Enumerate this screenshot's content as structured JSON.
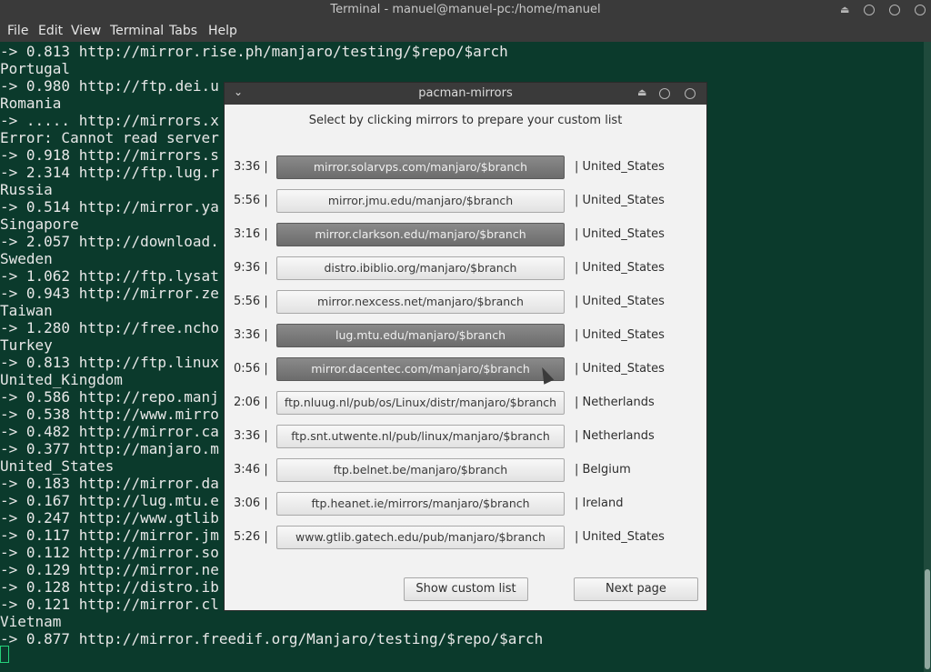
{
  "window": {
    "title": "Terminal - manuel@manuel-pc:/home/manuel"
  },
  "menu": [
    "File",
    "Edit",
    "View",
    "Terminal",
    "Tabs",
    "Help"
  ],
  "terminal": {
    "lines": [
      "-> 0.813 http://mirror.rise.ph/manjaro/testing/$repo/$arch",
      "Portugal",
      "-> 0.980 http://ftp.dei.u",
      "Romania",
      "-> ..... http://mirrors.x",
      "Error: Cannot read server",
      "-> 0.918 http://mirrors.s",
      "-> 2.314 http://ftp.lug.r",
      "Russia",
      "-> 0.514 http://mirror.ya",
      "Singapore",
      "-> 2.057 http://download.",
      "Sweden",
      "-> 1.062 http://ftp.lysat",
      "-> 0.943 http://mirror.ze",
      "Taiwan",
      "-> 1.280 http://free.ncho",
      "Turkey",
      "-> 0.813 http://ftp.linux",
      "United_Kingdom",
      "-> 0.586 http://repo.manj",
      "-> 0.538 http://www.mirro                                        epo/$arch",
      "-> 0.482 http://mirror.ca",
      "-> 0.377 http://manjaro.m",
      "United_States",
      "-> 0.183 http://mirror.da",
      "-> 0.167 http://lug.mtu.e",
      "-> 0.247 http://www.gtlib",
      "-> 0.117 http://mirror.jm",
      "-> 0.112 http://mirror.so",
      "-> 0.129 http://mirror.ne",
      "-> 0.128 http://distro.ib",
      "-> 0.121 http://mirror.cl",
      "Vietnam",
      "-> 0.877 http://mirror.freedif.org/Manjaro/testing/$repo/$arch"
    ]
  },
  "dialog": {
    "title": "pacman-mirrors",
    "instruction": "Select by clicking mirrors to prepare your custom list",
    "mirrors": [
      {
        "time": "3:36 |",
        "url": "mirror.solarvps.com/manjaro/$branch",
        "country": "| United_States",
        "selected": true
      },
      {
        "time": "5:56 |",
        "url": "mirror.jmu.edu/manjaro/$branch",
        "country": "| United_States",
        "selected": false
      },
      {
        "time": "3:16 |",
        "url": "mirror.clarkson.edu/manjaro/$branch",
        "country": "| United_States",
        "selected": true
      },
      {
        "time": "9:36 |",
        "url": "distro.ibiblio.org/manjaro/$branch",
        "country": "| United_States",
        "selected": false
      },
      {
        "time": "5:56 |",
        "url": "mirror.nexcess.net/manjaro/$branch",
        "country": "| United_States",
        "selected": false
      },
      {
        "time": "3:36 |",
        "url": "lug.mtu.edu/manjaro/$branch",
        "country": "| United_States",
        "selected": true
      },
      {
        "time": "0:56 |",
        "url": "mirror.dacentec.com/manjaro/$branch",
        "country": "| United_States",
        "selected": true
      },
      {
        "time": "2:06 |",
        "url": "ftp.nluug.nl/pub/os/Linux/distr/manjaro/$branch",
        "country": "| Netherlands",
        "selected": false
      },
      {
        "time": "3:36 |",
        "url": "ftp.snt.utwente.nl/pub/linux/manjaro/$branch",
        "country": "| Netherlands",
        "selected": false
      },
      {
        "time": "3:46 |",
        "url": "ftp.belnet.be/manjaro/$branch",
        "country": "| Belgium",
        "selected": false
      },
      {
        "time": "3:06 |",
        "url": "ftp.heanet.ie/mirrors/manjaro/$branch",
        "country": "| Ireland",
        "selected": false
      },
      {
        "time": "5:26 |",
        "url": "www.gtlib.gatech.edu/pub/manjaro/$branch",
        "country": "| United_States",
        "selected": false
      }
    ],
    "show_custom_label": "Show custom list",
    "next_page_label": "Next page"
  }
}
